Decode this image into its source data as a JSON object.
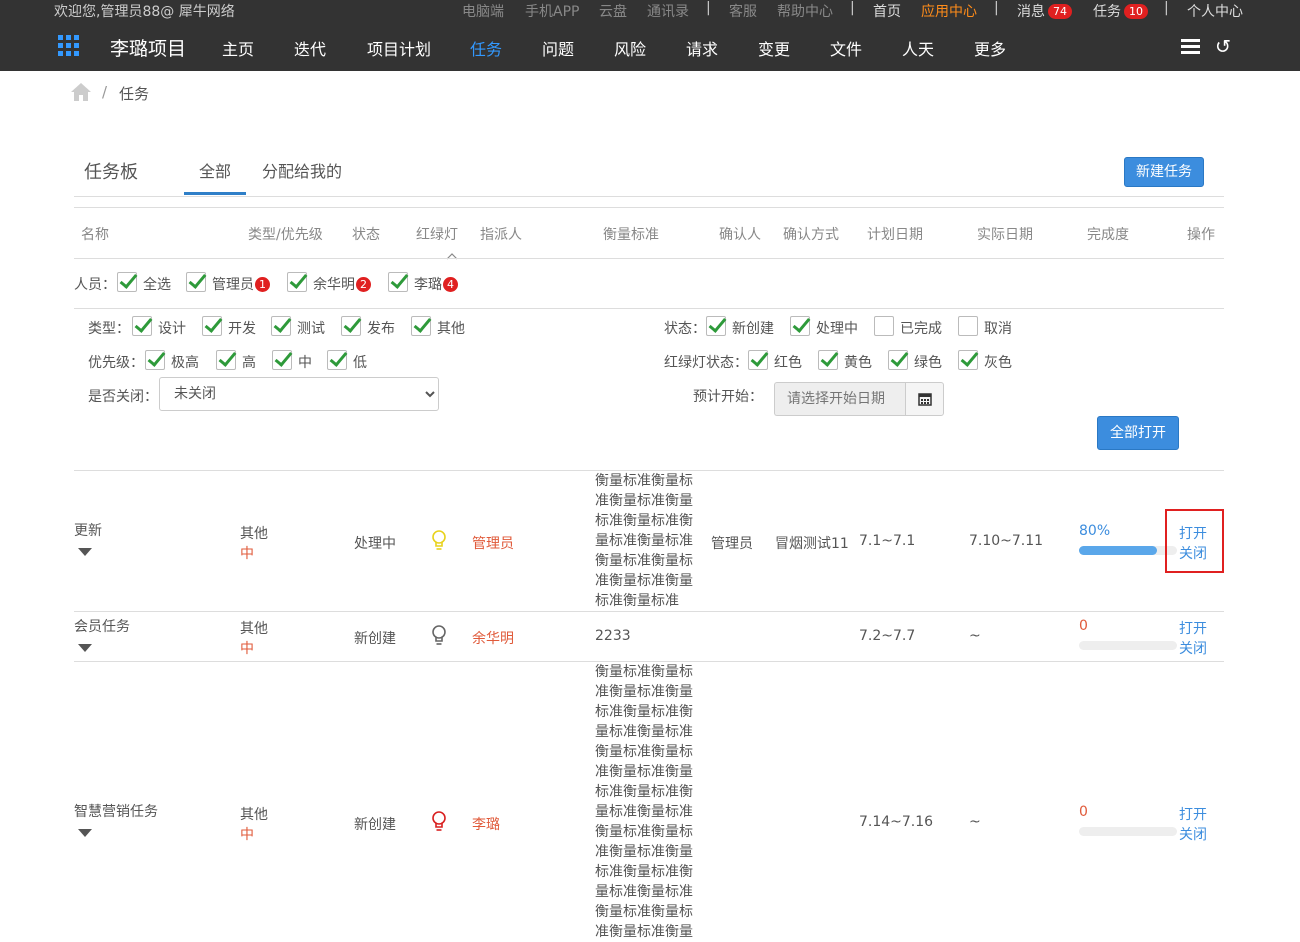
{
  "topbar": {
    "welcome": "欢迎您,管理员88@ 犀牛网络",
    "links": [
      "电脑端",
      "手机APP",
      "云盘",
      "通讯录",
      "客服",
      "帮助中心",
      "首页",
      "应用中心",
      "消息",
      "任务",
      "个人中心"
    ],
    "msg_count": "74",
    "task_count": "10"
  },
  "navbar": {
    "project": "李璐项目",
    "items": [
      "主页",
      "迭代",
      "项目计划",
      "任务",
      "问题",
      "风险",
      "请求",
      "变更",
      "文件",
      "人天",
      "更多"
    ],
    "active": "任务",
    "back_icon": "↺"
  },
  "breadcrumb": {
    "sep": "/",
    "current": "任务"
  },
  "board": {
    "title": "任务板",
    "tabs": [
      "全部",
      "分配给我的"
    ],
    "new_task": "新建任务"
  },
  "columns": [
    "名称",
    "类型/优先级",
    "状态",
    "红绿灯",
    "指派人",
    "衡量标准",
    "确认人",
    "确认方式",
    "计划日期",
    "实际日期",
    "完成度",
    "操作"
  ],
  "people": {
    "label": "人员：",
    "items": [
      {
        "name": "全选",
        "badge": ""
      },
      {
        "name": "管理员",
        "badge": "1"
      },
      {
        "name": "余华明",
        "badge": "2"
      },
      {
        "name": "李璐",
        "badge": "4"
      }
    ]
  },
  "filters": {
    "type": {
      "label": "类型：",
      "items": [
        "设计",
        "开发",
        "测试",
        "发布",
        "其他"
      ]
    },
    "priority": {
      "label": "优先级：",
      "items": [
        "极高",
        "高",
        "中",
        "低"
      ]
    },
    "closed": {
      "label": "是否关闭：",
      "value": "未关闭"
    },
    "status": {
      "label": "状态：",
      "items": [
        "新创建",
        "处理中",
        "已完成",
        "取消"
      ],
      "checked": [
        true,
        true,
        false,
        false
      ]
    },
    "light": {
      "label": "红绿灯状态：",
      "items": [
        "红色",
        "黄色",
        "绿色",
        "灰色"
      ]
    },
    "start": {
      "label": "预计开始：",
      "placeholder": "请选择开始日期"
    },
    "open_all": "全部打开"
  },
  "rows": [
    {
      "name": "更新",
      "type": "其他",
      "priority": "中",
      "status": "处理中",
      "light": "yellow",
      "assignee": "管理员",
      "measure": "衡量标准衡量标准衡量标准衡量标准衡量标准衡量标准衡量标准衡量标准衡量标准衡量标准衡量标准衡量标准",
      "confirmer": "管理员",
      "confirm_method": "冒烟测试11",
      "plan": "7.1~7.1",
      "actual": "7.10~7.11",
      "progress": "80%",
      "progress_value": 80,
      "open": "打开",
      "close": "关闭"
    },
    {
      "name": "会员任务",
      "type": "其他",
      "priority": "中",
      "status": "新创建",
      "light": "gray",
      "assignee": "余华明",
      "measure": "2233",
      "confirmer": "",
      "confirm_method": "",
      "plan": "7.2~7.7",
      "actual": "~",
      "progress": "0",
      "progress_value": 0,
      "open": "打开",
      "close": "关闭"
    },
    {
      "name": "智慧营销任务",
      "type": "其他",
      "priority": "中",
      "status": "新创建",
      "light": "red",
      "assignee": "李璐",
      "measure": "衡量标准衡量标准衡量标准衡量标准衡量标准衡量标准衡量标准衡量标准衡量标准衡量标准衡量标准衡量标准衡量标准衡量标准衡量标准衡量标准衡量标准衡量标准衡量标准衡量标准衡量标准衡量标准衡量标准衡量标准衡量",
      "confirmer": "",
      "confirm_method": "",
      "plan": "7.14~7.16",
      "actual": "~",
      "progress": "0",
      "progress_value": 0,
      "open": "打开",
      "close": "关闭"
    }
  ],
  "colors": {
    "accent": "#3c8dde",
    "bar": "#333333",
    "badge": "#e02020",
    "orange": "#ff8c1a"
  }
}
